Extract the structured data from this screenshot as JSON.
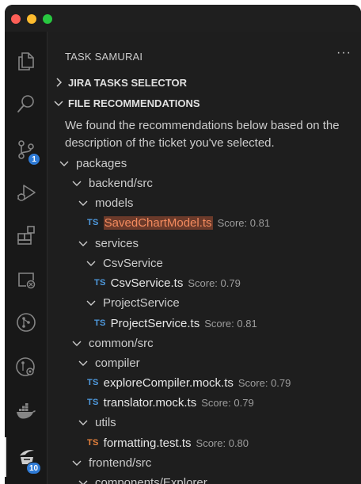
{
  "panel": {
    "title": "TASK SAMURAI",
    "more_label": "···"
  },
  "sections": {
    "jira": {
      "label": "JIRA TASKS SELECTOR"
    },
    "files": {
      "label": "FILE RECOMMENDATIONS",
      "description": "We found the recommendations below based on the description of the ticket you've selected."
    }
  },
  "activity_badges": {
    "source_control": "1",
    "task_samurai": "10"
  },
  "tree": {
    "packages": "packages",
    "backend": "backend/src",
    "models": "models",
    "saved_chart": {
      "icon": "TS",
      "name": "SavedChartModel.ts",
      "score": "Score: 0.81"
    },
    "services": "services",
    "csv_service_folder": "CsvService",
    "csv_service": {
      "icon": "TS",
      "name": "CsvService.ts",
      "score": "Score: 0.79"
    },
    "project_service_folder": "ProjectService",
    "project_service": {
      "icon": "TS",
      "name": "ProjectService.ts",
      "score": "Score: 0.81"
    },
    "common": "common/src",
    "compiler": "compiler",
    "explore_compiler": {
      "icon": "TS",
      "name": "exploreCompiler.mock.ts",
      "score": "Score: 0.79"
    },
    "translator": {
      "icon": "TS",
      "name": "translator.mock.ts",
      "score": "Score: 0.79"
    },
    "utils": "utils",
    "formatting": {
      "icon": "TS",
      "name": "formatting.test.ts",
      "score": "Score: 0.80"
    },
    "frontend": "frontend/src",
    "components_explorer": "components/Explorer"
  },
  "colors": {
    "accent": "#2f7bd6",
    "highlight_bg": "#6b3a2a",
    "ts_blue": "#4f9be0",
    "ts_orange": "#e8823c"
  }
}
